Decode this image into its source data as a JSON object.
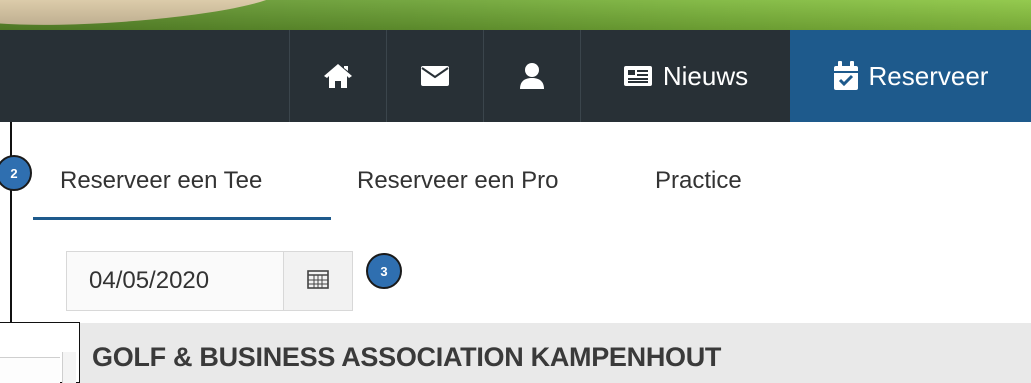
{
  "navbar": {
    "items": [
      {
        "icon": "home-icon"
      },
      {
        "icon": "envelope-icon"
      },
      {
        "icon": "user-icon"
      },
      {
        "icon": "newspaper-icon",
        "label": "Nieuws"
      },
      {
        "icon": "calendar-check-icon",
        "label": "Reserveer",
        "active": true
      }
    ],
    "background": "#283036",
    "active_color": "#1e5a8c"
  },
  "tabs": [
    {
      "label": "Reserveer een Tee",
      "active": true
    },
    {
      "label": "Reserveer een Pro"
    },
    {
      "label": "Practice"
    }
  ],
  "date_picker": {
    "value": "04/05/2020",
    "icon": "calendar-icon"
  },
  "badges": {
    "step2": "2",
    "step3": "3"
  },
  "club": {
    "name": "GOLF & BUSINESS ASSOCIATION KAMPENHOUT"
  }
}
